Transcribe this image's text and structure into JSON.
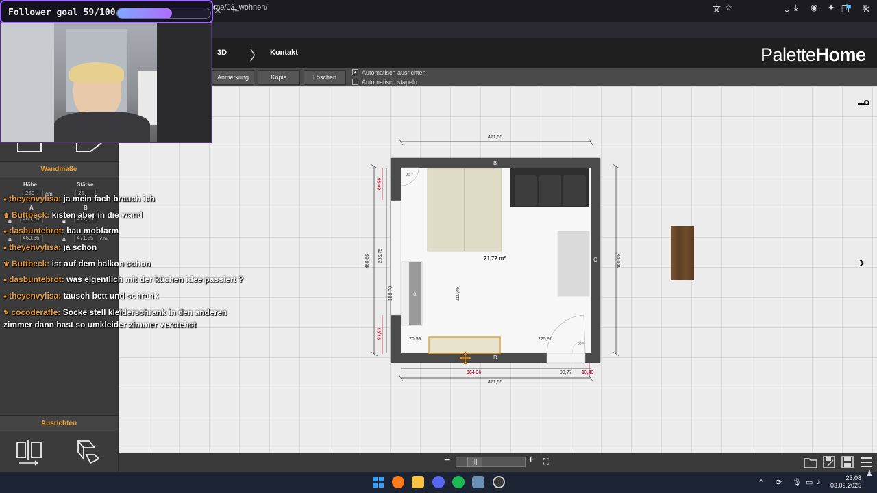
{
  "overlay": {
    "goal_text": "Follower goal 59/100",
    "goal_fraction": 0.59
  },
  "browser": {
    "url": "ome/03_wohnen/",
    "tab_close": "✕",
    "tab_new": "+"
  },
  "header": {
    "crumbs": [
      "3D",
      "Kontakt"
    ],
    "logo_a": "Palette",
    "logo_b": "Home"
  },
  "toolbar": {
    "buttons": [
      "Anmerkung",
      "Kopie",
      "Löschen"
    ],
    "checks": [
      {
        "label": "Automatisch ausrichten",
        "checked": true
      },
      {
        "label": "Automatisch stapeln",
        "checked": false
      }
    ]
  },
  "left_panel": {
    "wall_title": "Wandmaße",
    "hoehe_label": "Höhe",
    "staerke_label": "Stärke",
    "hoehe_value": "250",
    "staerke_value": "25",
    "unit": "cm",
    "a_label": "A",
    "b_label": "B",
    "a_value": "460,66",
    "b_value": "471,55",
    "align_title": "Ausrichten"
  },
  "chat": [
    {
      "user": "theyenvylisa:",
      "msg": "ja mein fach brauch ich",
      "icon": "♦"
    },
    {
      "user": "Buttbeck:",
      "msg": "kisten aber in die wand",
      "icon": "♛"
    },
    {
      "user": "dasbuntebrot:",
      "msg": "bau mobfarm",
      "icon": "♦"
    },
    {
      "user": "theyenvylisa:",
      "msg": "ja schon",
      "icon": "♦"
    },
    {
      "user": "Buttbeck:",
      "msg": "ist auf dem balkon schon",
      "icon": "♛"
    },
    {
      "user": "dasbuntebrot:",
      "msg": "was eigentlich mit der küchen idee passiert ?",
      "icon": "♦"
    },
    {
      "user": "theyenvylisa:",
      "msg": "tausch bett und schrank",
      "icon": "♦"
    },
    {
      "user": "cocoderaffe:",
      "msg": "Socke stell kleiderschrank in den anderen",
      "icon": "✎"
    },
    {
      "user": "",
      "msg": "zimmer dann hast so umkleider zimmer verstehst",
      "icon": ""
    }
  ],
  "plan": {
    "wall_B": "B",
    "wall_C": "C",
    "wall_D": "D",
    "wall_a": "a",
    "area": "21,72 m²",
    "dim_top": "471,55",
    "dim_bottom": "471,55",
    "dim_left_outer": "460,66",
    "dim_right_outer": "460,66",
    "dim_left_1": "80,98",
    "dim_left_2": "285,75",
    "dim_left_3": "158,70",
    "dim_left_4": "93,93",
    "dim_inner_vert": "210,46",
    "dim_bottom_1": "364,36",
    "dim_bottom_2": "93,77",
    "dim_bottom_3": "13,43",
    "dim_sel_left": "70,59",
    "dim_sel_right": "225,96",
    "angle": "90 °",
    "angle2": "90 °"
  },
  "bottombar": {
    "minus": "−",
    "thumb": "|||",
    "plus": "+",
    "fit": "⛶"
  },
  "taskbar": {
    "time": "23:08",
    "date": "03.09.2025"
  },
  "colors": {
    "accent": "#e8a13a",
    "wall": "#4b4b4b",
    "dim_red": "#b2243c",
    "selection": "#e8a13a"
  }
}
